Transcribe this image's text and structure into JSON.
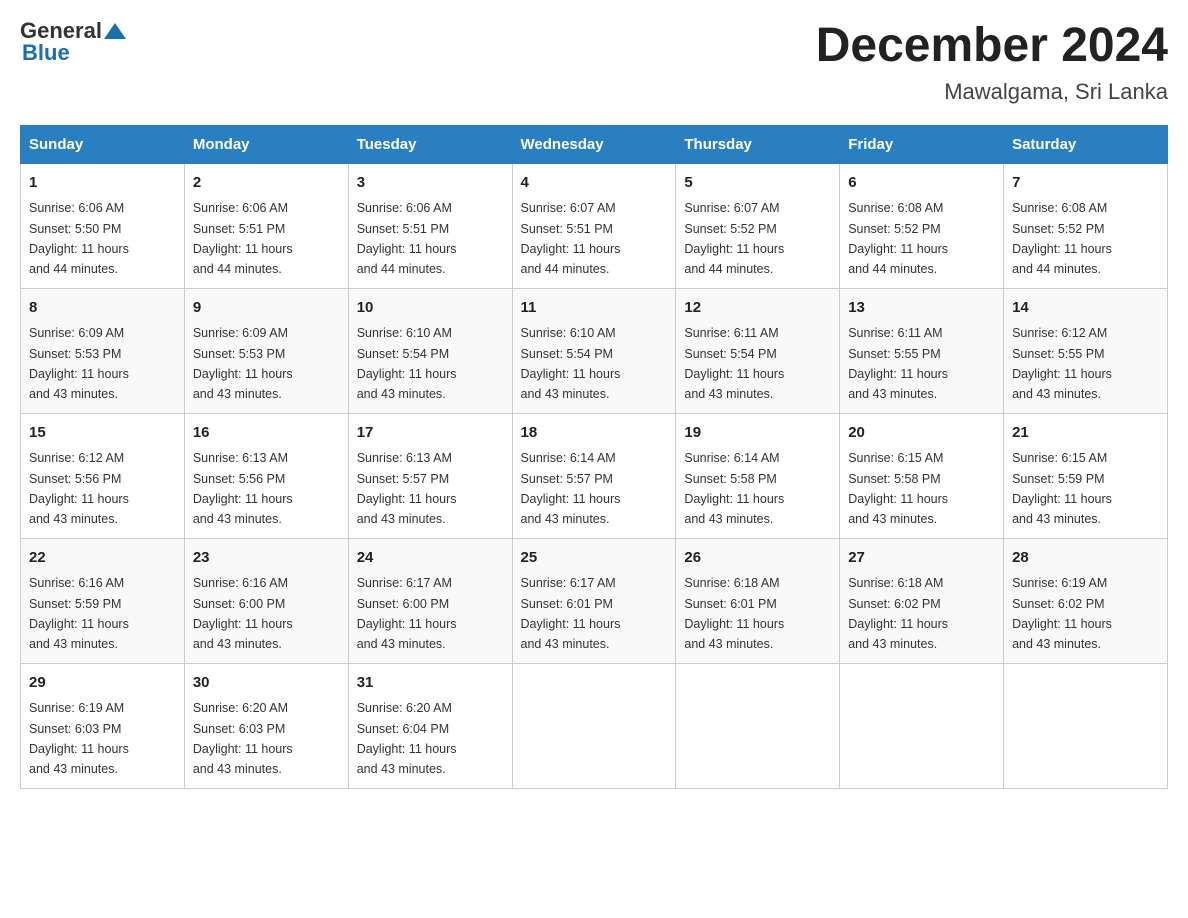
{
  "header": {
    "logo_general": "General",
    "logo_blue": "Blue",
    "title": "December 2024",
    "subtitle": "Mawalgama, Sri Lanka"
  },
  "days_of_week": [
    "Sunday",
    "Monday",
    "Tuesday",
    "Wednesday",
    "Thursday",
    "Friday",
    "Saturday"
  ],
  "weeks": [
    [
      {
        "day": "1",
        "sunrise": "6:06 AM",
        "sunset": "5:50 PM",
        "daylight": "11 hours and 44 minutes."
      },
      {
        "day": "2",
        "sunrise": "6:06 AM",
        "sunset": "5:51 PM",
        "daylight": "11 hours and 44 minutes."
      },
      {
        "day": "3",
        "sunrise": "6:06 AM",
        "sunset": "5:51 PM",
        "daylight": "11 hours and 44 minutes."
      },
      {
        "day": "4",
        "sunrise": "6:07 AM",
        "sunset": "5:51 PM",
        "daylight": "11 hours and 44 minutes."
      },
      {
        "day": "5",
        "sunrise": "6:07 AM",
        "sunset": "5:52 PM",
        "daylight": "11 hours and 44 minutes."
      },
      {
        "day": "6",
        "sunrise": "6:08 AM",
        "sunset": "5:52 PM",
        "daylight": "11 hours and 44 minutes."
      },
      {
        "day": "7",
        "sunrise": "6:08 AM",
        "sunset": "5:52 PM",
        "daylight": "11 hours and 44 minutes."
      }
    ],
    [
      {
        "day": "8",
        "sunrise": "6:09 AM",
        "sunset": "5:53 PM",
        "daylight": "11 hours and 43 minutes."
      },
      {
        "day": "9",
        "sunrise": "6:09 AM",
        "sunset": "5:53 PM",
        "daylight": "11 hours and 43 minutes."
      },
      {
        "day": "10",
        "sunrise": "6:10 AM",
        "sunset": "5:54 PM",
        "daylight": "11 hours and 43 minutes."
      },
      {
        "day": "11",
        "sunrise": "6:10 AM",
        "sunset": "5:54 PM",
        "daylight": "11 hours and 43 minutes."
      },
      {
        "day": "12",
        "sunrise": "6:11 AM",
        "sunset": "5:54 PM",
        "daylight": "11 hours and 43 minutes."
      },
      {
        "day": "13",
        "sunrise": "6:11 AM",
        "sunset": "5:55 PM",
        "daylight": "11 hours and 43 minutes."
      },
      {
        "day": "14",
        "sunrise": "6:12 AM",
        "sunset": "5:55 PM",
        "daylight": "11 hours and 43 minutes."
      }
    ],
    [
      {
        "day": "15",
        "sunrise": "6:12 AM",
        "sunset": "5:56 PM",
        "daylight": "11 hours and 43 minutes."
      },
      {
        "day": "16",
        "sunrise": "6:13 AM",
        "sunset": "5:56 PM",
        "daylight": "11 hours and 43 minutes."
      },
      {
        "day": "17",
        "sunrise": "6:13 AM",
        "sunset": "5:57 PM",
        "daylight": "11 hours and 43 minutes."
      },
      {
        "day": "18",
        "sunrise": "6:14 AM",
        "sunset": "5:57 PM",
        "daylight": "11 hours and 43 minutes."
      },
      {
        "day": "19",
        "sunrise": "6:14 AM",
        "sunset": "5:58 PM",
        "daylight": "11 hours and 43 minutes."
      },
      {
        "day": "20",
        "sunrise": "6:15 AM",
        "sunset": "5:58 PM",
        "daylight": "11 hours and 43 minutes."
      },
      {
        "day": "21",
        "sunrise": "6:15 AM",
        "sunset": "5:59 PM",
        "daylight": "11 hours and 43 minutes."
      }
    ],
    [
      {
        "day": "22",
        "sunrise": "6:16 AM",
        "sunset": "5:59 PM",
        "daylight": "11 hours and 43 minutes."
      },
      {
        "day": "23",
        "sunrise": "6:16 AM",
        "sunset": "6:00 PM",
        "daylight": "11 hours and 43 minutes."
      },
      {
        "day": "24",
        "sunrise": "6:17 AM",
        "sunset": "6:00 PM",
        "daylight": "11 hours and 43 minutes."
      },
      {
        "day": "25",
        "sunrise": "6:17 AM",
        "sunset": "6:01 PM",
        "daylight": "11 hours and 43 minutes."
      },
      {
        "day": "26",
        "sunrise": "6:18 AM",
        "sunset": "6:01 PM",
        "daylight": "11 hours and 43 minutes."
      },
      {
        "day": "27",
        "sunrise": "6:18 AM",
        "sunset": "6:02 PM",
        "daylight": "11 hours and 43 minutes."
      },
      {
        "day": "28",
        "sunrise": "6:19 AM",
        "sunset": "6:02 PM",
        "daylight": "11 hours and 43 minutes."
      }
    ],
    [
      {
        "day": "29",
        "sunrise": "6:19 AM",
        "sunset": "6:03 PM",
        "daylight": "11 hours and 43 minutes."
      },
      {
        "day": "30",
        "sunrise": "6:20 AM",
        "sunset": "6:03 PM",
        "daylight": "11 hours and 43 minutes."
      },
      {
        "day": "31",
        "sunrise": "6:20 AM",
        "sunset": "6:04 PM",
        "daylight": "11 hours and 43 minutes."
      },
      null,
      null,
      null,
      null
    ]
  ],
  "labels": {
    "sunrise": "Sunrise:",
    "sunset": "Sunset:",
    "daylight": "Daylight:"
  }
}
